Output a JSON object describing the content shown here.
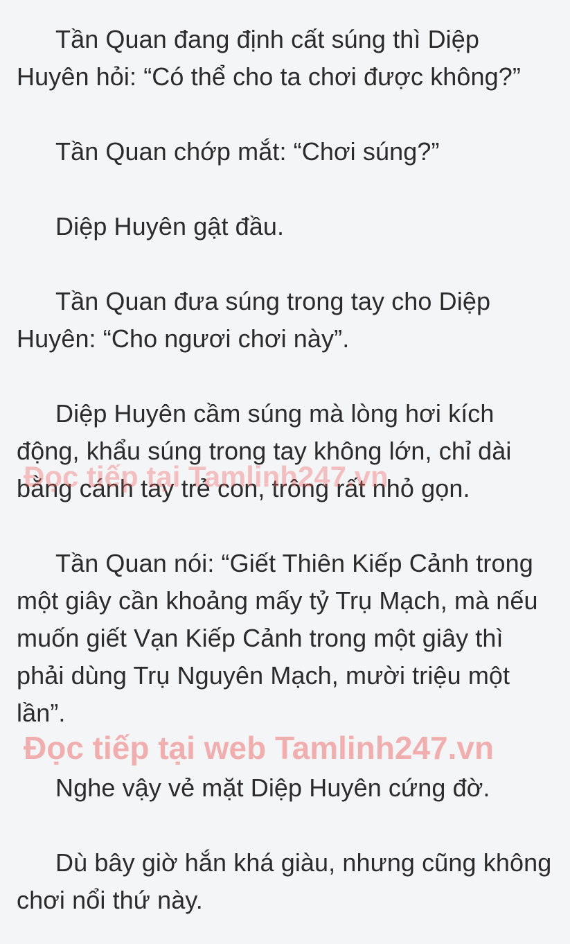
{
  "paragraphs": [
    "Tần Quan đang định cất súng thì Diệp Huyên hỏi: “Có thể cho ta chơi được không?”",
    "Tần Quan chớp mắt: “Chơi súng?”",
    "Diệp Huyên gật đầu.",
    "Tần Quan đưa súng trong tay cho Diệp Huyên: “Cho ngươi chơi này”.",
    "Diệp Huyên cầm súng mà lòng hơi kích động, khẩu súng trong tay không lớn, chỉ dài bằng cánh tay trẻ con, trông rất nhỏ gọn.",
    "Tần Quan nói: “Giết Thiên Kiếp Cảnh trong một giây cần khoảng mấy tỷ Trụ Mạch, mà nếu muốn giết Vạn Kiếp Cảnh trong một giây thì phải dùng Trụ Nguyên Mạch, mười triệu một lần”.",
    "Nghe vậy vẻ mặt Diệp Huyên cứng đờ.",
    "Dù bây giờ hắn khá giàu, nhưng cũng không chơi nổi thứ này."
  ],
  "watermarks": [
    "Đọc tiếp tại Tamlinh247.vn",
    "Đọc tiếp tại web Tamlinh247.vn"
  ]
}
